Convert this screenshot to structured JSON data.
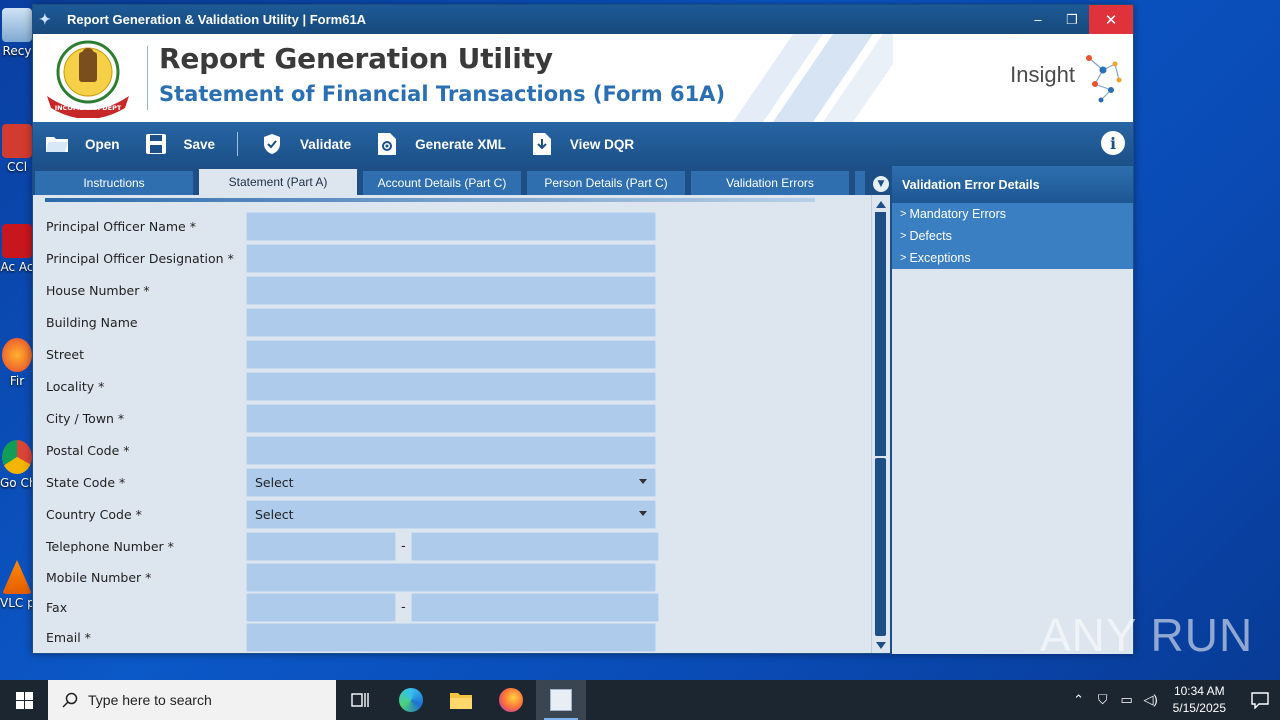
{
  "desktop": {
    "icons": [
      {
        "label": "Recy"
      },
      {
        "label": "CCl"
      },
      {
        "label": "Ac Ac"
      },
      {
        "label": "Fir"
      },
      {
        "label": "Go Ch"
      },
      {
        "label": "VLC pl"
      }
    ]
  },
  "window": {
    "title": "Report Generation & Validation Utility | Form61A",
    "controls": {
      "minimize": "–",
      "restore": "❐",
      "close": "✕"
    }
  },
  "banner": {
    "title": "Report Generation Utility",
    "subtitle": "Statement of Financial Transactions (Form 61A)",
    "brand": "Insight",
    "emblem_text": "INCOME TAX DEPARTMENT"
  },
  "toolbar": {
    "items": [
      {
        "label": "Open",
        "icon": "folder-open-icon"
      },
      {
        "label": "Save",
        "icon": "save-icon"
      },
      {
        "label": "Validate",
        "icon": "shield-check-icon"
      },
      {
        "label": "Generate XML",
        "icon": "xml-file-icon"
      },
      {
        "label": "View DQR",
        "icon": "download-file-icon"
      }
    ],
    "info_icon": "i"
  },
  "tabs": [
    {
      "label": "Instructions",
      "active": false
    },
    {
      "label": "Statement (Part A)",
      "active": true
    },
    {
      "label": "Account Details (Part C)",
      "active": false
    },
    {
      "label": "Person Details (Part C)",
      "active": false
    },
    {
      "label": "Validation Errors",
      "active": false
    }
  ],
  "form": {
    "fields": [
      {
        "label": "Principal Officer Name *",
        "value": ""
      },
      {
        "label": "Principal Officer Designation *",
        "value": ""
      },
      {
        "label": "House Number *",
        "value": ""
      },
      {
        "label": "Building Name",
        "value": ""
      },
      {
        "label": "Street",
        "value": ""
      },
      {
        "label": "Locality *",
        "value": ""
      },
      {
        "label": "City / Town *",
        "value": ""
      },
      {
        "label": "Postal Code *",
        "value": ""
      },
      {
        "label": "State Code *",
        "value": "Select"
      },
      {
        "label": "Country Code *",
        "value": "Select"
      },
      {
        "label": "Telephone Number *",
        "value": "",
        "separator": "-"
      },
      {
        "label": "Mobile Number *",
        "value": ""
      },
      {
        "label": "Fax",
        "value": "",
        "separator": "-"
      },
      {
        "label": "Email *",
        "value": ""
      }
    ]
  },
  "validation_panel": {
    "title": "Validation Error Details",
    "nodes": [
      "Mandatory Errors",
      "Defects",
      "Exceptions"
    ]
  },
  "taskbar": {
    "search_placeholder": "Type here to search",
    "time": "10:34 AM",
    "date": "5/15/2025"
  },
  "watermark": "ANY RUN",
  "colors": {
    "titlebar": "#1d5a96",
    "field_bg": "#aecbec",
    "accent": "#1d4f86",
    "panel_node": "#3a7fc1"
  }
}
